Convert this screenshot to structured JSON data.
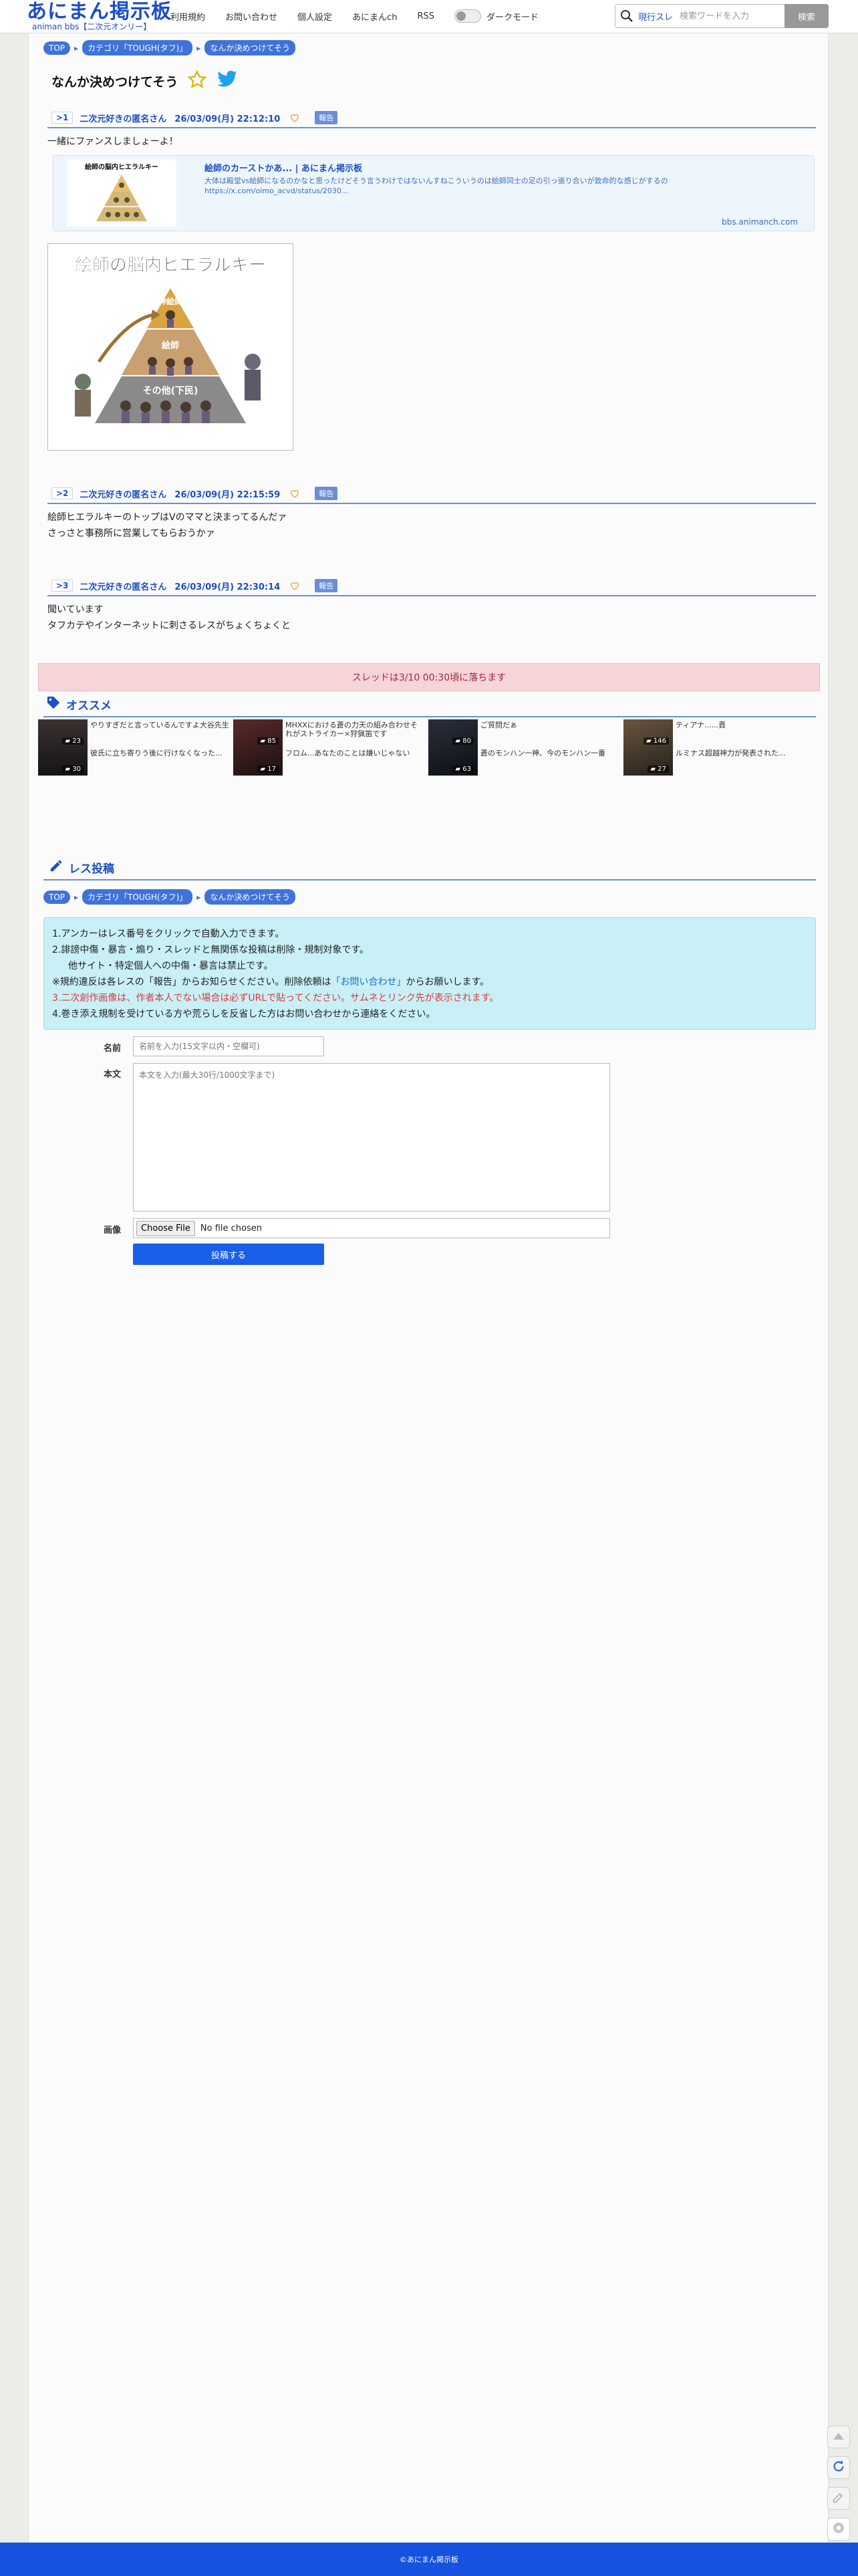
{
  "header": {
    "logo_main": "あにまん掲示板",
    "logo_sub": "animan bbs【二次元オンリー】",
    "nav": [
      "利用規約",
      "お問い合わせ",
      "個人設定",
      "あにまんch",
      "RSS"
    ],
    "dark_mode_label": "ダークモード",
    "search_scope": "現行スレ",
    "search_placeholder": "検索ワードを入力",
    "search_button": "検索"
  },
  "breadcrumb": {
    "items": [
      "TOP",
      "カテゴリ「TOUGH(タフ)」",
      "なんか決めつけてそう"
    ]
  },
  "thread": {
    "title": "なんか決めつけてそう"
  },
  "posts": [
    {
      "num": ">1",
      "name": "二次元好きの匿名さん",
      "date": "26/03/09(月) 22:12:10",
      "report": "報告",
      "body": "一緒にファンスしましょーよ！",
      "link_card": {
        "thumb_text": "絵師の脳内ヒエラルキー",
        "title": "絵師のカーストかあ... | あにまん掲示板",
        "desc": "大体は殿堂vs絵師になるのかなと思ったけどそう言うわけではないんすねこういうのは絵師同士の足の引っ張り合いが致命的な感じがするの",
        "url": "https://x.com/oimo_acvd/status/2030...",
        "domain": "bbs.animanch.com"
      },
      "image": {
        "title": "絵師の脳内ヒエラルキー",
        "labels": [
          "神絵師",
          "絵師",
          "その他(下民)"
        ]
      }
    },
    {
      "num": ">2",
      "name": "二次元好きの匿名さん",
      "date": "26/03/09(月) 22:15:59",
      "report": "報告",
      "lines": [
        "絵師ヒエラルキーのトップはVのママと決まってるんだァ",
        "さっさと事務所に営業してもらおうかァ"
      ]
    },
    {
      "num": ">3",
      "name": "二次元好きの匿名さん",
      "date": "26/03/09(月) 22:30:14",
      "report": "報告",
      "lines": [
        "聞いています",
        "タフカテやインターネットに刺さるレスがちょくちょくと"
      ]
    }
  ],
  "banner": "スレッドは3/10 00:30頃に落ちます",
  "recommend": {
    "title": "オススメ",
    "items": [
      {
        "count": "23",
        "text": "やりすぎだと言っているんですよ大谷先生"
      },
      {
        "count": "30",
        "text": "彼氏に立ち寄りう後に行けなくなった..."
      },
      {
        "count": "85",
        "text": "MHXXにおける蒼の力天の組み合わせそれがストライカー×狩猟笛です"
      },
      {
        "count": "17",
        "text": "フロム...あなたのことは嫌いじゃない"
      },
      {
        "count": "80",
        "text": "ご質問だぁ"
      },
      {
        "count": "63",
        "text": "蒼のモンハン一神、今のモンハン一番"
      },
      {
        "count": "146",
        "text": "ティアナ......責"
      },
      {
        "count": "27",
        "text": "ルミナス超越神力が発表された..."
      }
    ]
  },
  "form": {
    "title": "レス投稿",
    "notes": [
      "1.アンカーはレス番号をクリックで自動入力できます。",
      "2.誹謗中傷・暴言・煽り・スレッドと無関係な投稿は削除・規制対象です。",
      "他サイト・特定個人への中傷・暴言は禁止です。",
      "※規約違反は各レスの「報告」からお知らせください。削除依頼は",
      "「お問い合わせ」",
      "からお願いします。",
      "3.二次創作画像は、作者本人でない場合は必ずURLで貼ってください。サムネとリンク先が表示されます。",
      "4.巻き添え規制を受けている方や荒らしを反省した方はお問い合わせから連絡をください。"
    ],
    "name_label": "名前",
    "name_placeholder": "名前を入力(15文字以内・空欄可)",
    "body_label": "本文",
    "body_placeholder": "本文を入力(最大30行/1000文字まで)",
    "image_label": "画像",
    "file_button": "Choose File",
    "file_status": "No file chosen",
    "submit": "投稿する"
  },
  "footer": "©あにまん掲示板",
  "colors": {
    "brand_blue": "#1b4fc4",
    "banner_bg": "#f6d5d8",
    "note_bg": "#c8f0f6",
    "footer_bg": "#1552e0"
  }
}
